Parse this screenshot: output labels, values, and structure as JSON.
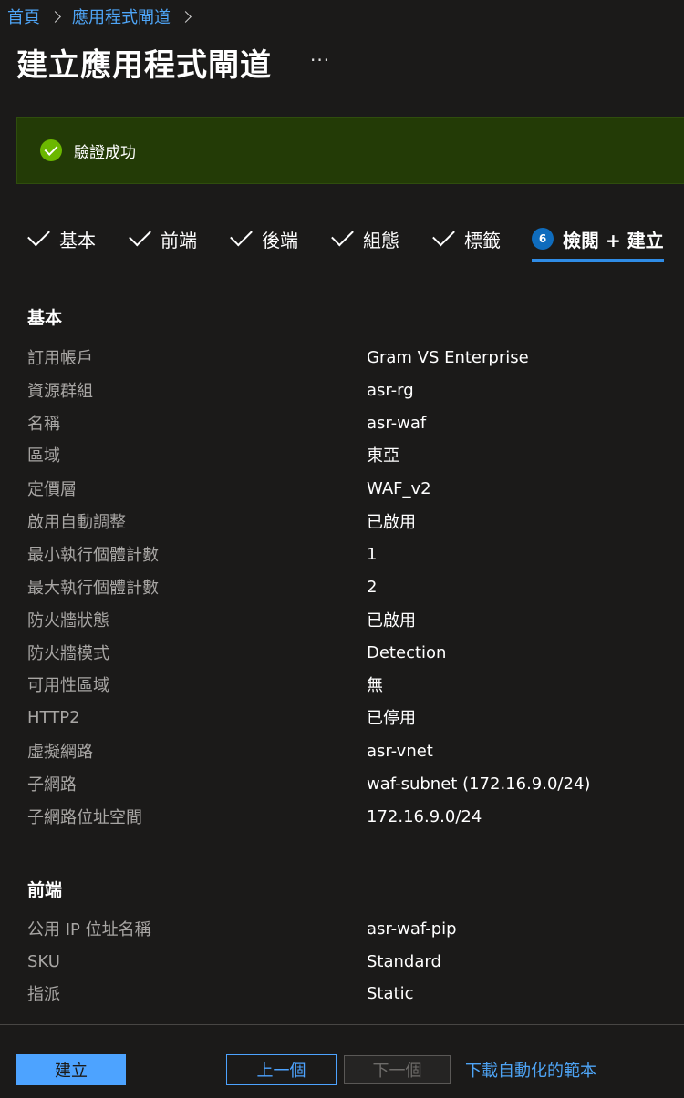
{
  "breadcrumb": {
    "home": "首頁",
    "parent": "應用程式閘道"
  },
  "page": {
    "title": "建立應用程式閘道",
    "more": "···"
  },
  "banner": {
    "message": "驗證成功"
  },
  "tabs": [
    {
      "label": "基本"
    },
    {
      "label": "前端"
    },
    {
      "label": "後端"
    },
    {
      "label": "組態"
    },
    {
      "label": "標籤"
    },
    {
      "label": "檢閱 + 建立",
      "step": "6"
    }
  ],
  "basics": {
    "title": "基本",
    "rows": [
      {
        "label": "訂用帳戶",
        "value": "Gram VS Enterprise"
      },
      {
        "label": "資源群組",
        "value": "asr-rg"
      },
      {
        "label": "名稱",
        "value": "asr-waf"
      },
      {
        "label": "區域",
        "value": "東亞"
      },
      {
        "label": "定價層",
        "value": "WAF_v2"
      },
      {
        "label": "啟用自動調整",
        "value": "已啟用"
      },
      {
        "label": "最小執行個體計數",
        "value": "1"
      },
      {
        "label": "最大執行個體計數",
        "value": "2"
      },
      {
        "label": "防火牆狀態",
        "value": "已啟用"
      },
      {
        "label": "防火牆模式",
        "value": "Detection"
      },
      {
        "label": "可用性區域",
        "value": "無"
      },
      {
        "label": "HTTP2",
        "value": "已停用"
      },
      {
        "label": "虛擬網路",
        "value": "asr-vnet"
      },
      {
        "label": "子網路",
        "value": "waf-subnet (172.16.9.0/24)"
      },
      {
        "label": "子網路位址空間",
        "value": "172.16.9.0/24"
      }
    ]
  },
  "frontend": {
    "title": "前端",
    "rows": [
      {
        "label": "公用 IP 位址名稱",
        "value": "asr-waf-pip"
      },
      {
        "label": "SKU",
        "value": "Standard"
      },
      {
        "label": "指派",
        "value": "Static"
      }
    ]
  },
  "footer": {
    "create": "建立",
    "previous": "上一個",
    "next": "下一個",
    "download": "下載自動化的範本"
  },
  "colors": {
    "accent": "#4da3ff",
    "success": "#6bb700",
    "banner_bg": "#233b06",
    "step_badge": "#0f6cbd"
  }
}
